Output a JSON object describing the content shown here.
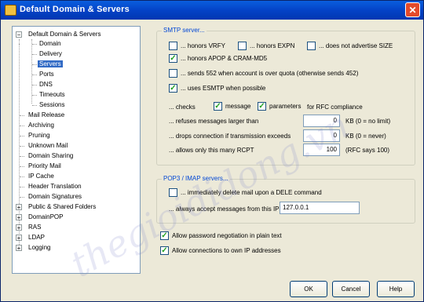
{
  "window": {
    "title": "Default Domain & Servers",
    "close_glyph": "✕"
  },
  "tree": {
    "root": "Default Domain & Servers",
    "children": [
      "Domain",
      "Delivery",
      "Servers",
      "Ports",
      "DNS",
      "Timeouts",
      "Sessions"
    ],
    "items": [
      "Mail Release",
      "Archiving",
      "Pruning",
      "Unknown Mail",
      "Domain Sharing",
      "Priority Mail",
      "IP Cache",
      "Header Translation",
      "Domain Signatures"
    ],
    "expandable": [
      "Public & Shared Folders",
      "DomainPOP",
      "RAS",
      "LDAP",
      "Logging"
    ],
    "selected": "Servers"
  },
  "smtp": {
    "legend": "SMTP server...",
    "vrfy": "... honors VRFY",
    "expn": "... honors EXPN",
    "size": "... does not advertise SIZE",
    "apop": "... honors APOP & CRAM-MD5",
    "send552": "... sends 552 when account is over quota (otherwise sends 452)",
    "esmtp": "... uses ESMTP when possible",
    "checks": "... checks",
    "message": "message",
    "parameters": "parameters",
    "rfc": "for RFC compliance",
    "refuses": "... refuses messages larger than",
    "refuses_val": "0",
    "refuses_note": "KB (0 = no limit)",
    "drops": "... drops connection if transmission exceeds",
    "drops_val": "0",
    "drops_note": "KB (0 = never)",
    "rcpt": "... allows only this many RCPT",
    "rcpt_val": "100",
    "rcpt_note": "(RFC says 100)"
  },
  "pop": {
    "legend": "POP3 / IMAP servers...",
    "dele": "... immediately delete mail upon a DELE command",
    "always": "... always accept messages from this IP",
    "ip": "127.0.0.1"
  },
  "options": {
    "password": "Allow password negotiation in plain text",
    "connections": "Allow connections to own IP addresses"
  },
  "buttons": {
    "ok": "OK",
    "cancel": "Cancel",
    "help": "Help"
  },
  "check_glyph": "✓",
  "expand_glyph": "+",
  "collapse_glyph": "−",
  "watermark": "thegioididong.vn"
}
